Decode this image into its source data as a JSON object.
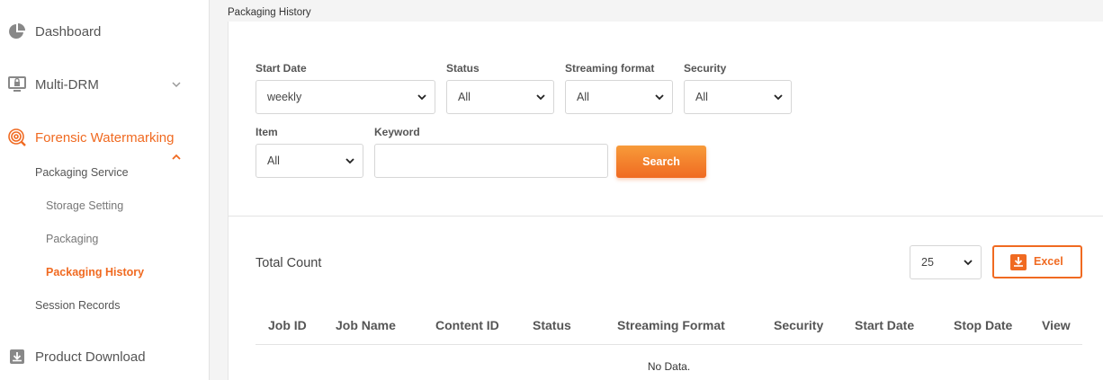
{
  "sidebar": {
    "items": [
      {
        "label": "Dashboard",
        "icon": "pie-chart-icon"
      },
      {
        "label": "Multi-DRM",
        "icon": "monitor-lock-icon"
      },
      {
        "label": "Forensic Watermarking",
        "icon": "fingerprint-icon"
      },
      {
        "label": "Product Download",
        "icon": "download-icon"
      }
    ],
    "sub_items": {
      "packaging_service": "Packaging Service",
      "storage_setting": "Storage Setting",
      "packaging": "Packaging",
      "packaging_history": "Packaging History",
      "session_records": "Session Records"
    },
    "accent_color": "#f06a21"
  },
  "page": {
    "title": "Packaging History"
  },
  "filters": {
    "start_date": {
      "label": "Start Date",
      "value": "weekly"
    },
    "status": {
      "label": "Status",
      "value": "All"
    },
    "streaming_format": {
      "label": "Streaming format",
      "value": "All"
    },
    "security": {
      "label": "Security",
      "value": "All"
    },
    "item": {
      "label": "Item",
      "value": "All"
    },
    "keyword": {
      "label": "Keyword",
      "value": ""
    },
    "search_label": "Search"
  },
  "results": {
    "total_label": "Total Count",
    "page_size": "25",
    "excel_label": "Excel",
    "columns": [
      "Job ID",
      "Job Name",
      "Content ID",
      "Status",
      "Streaming Format",
      "Security",
      "Start Date",
      "Stop Date",
      "View"
    ],
    "empty_text": "No Data."
  }
}
